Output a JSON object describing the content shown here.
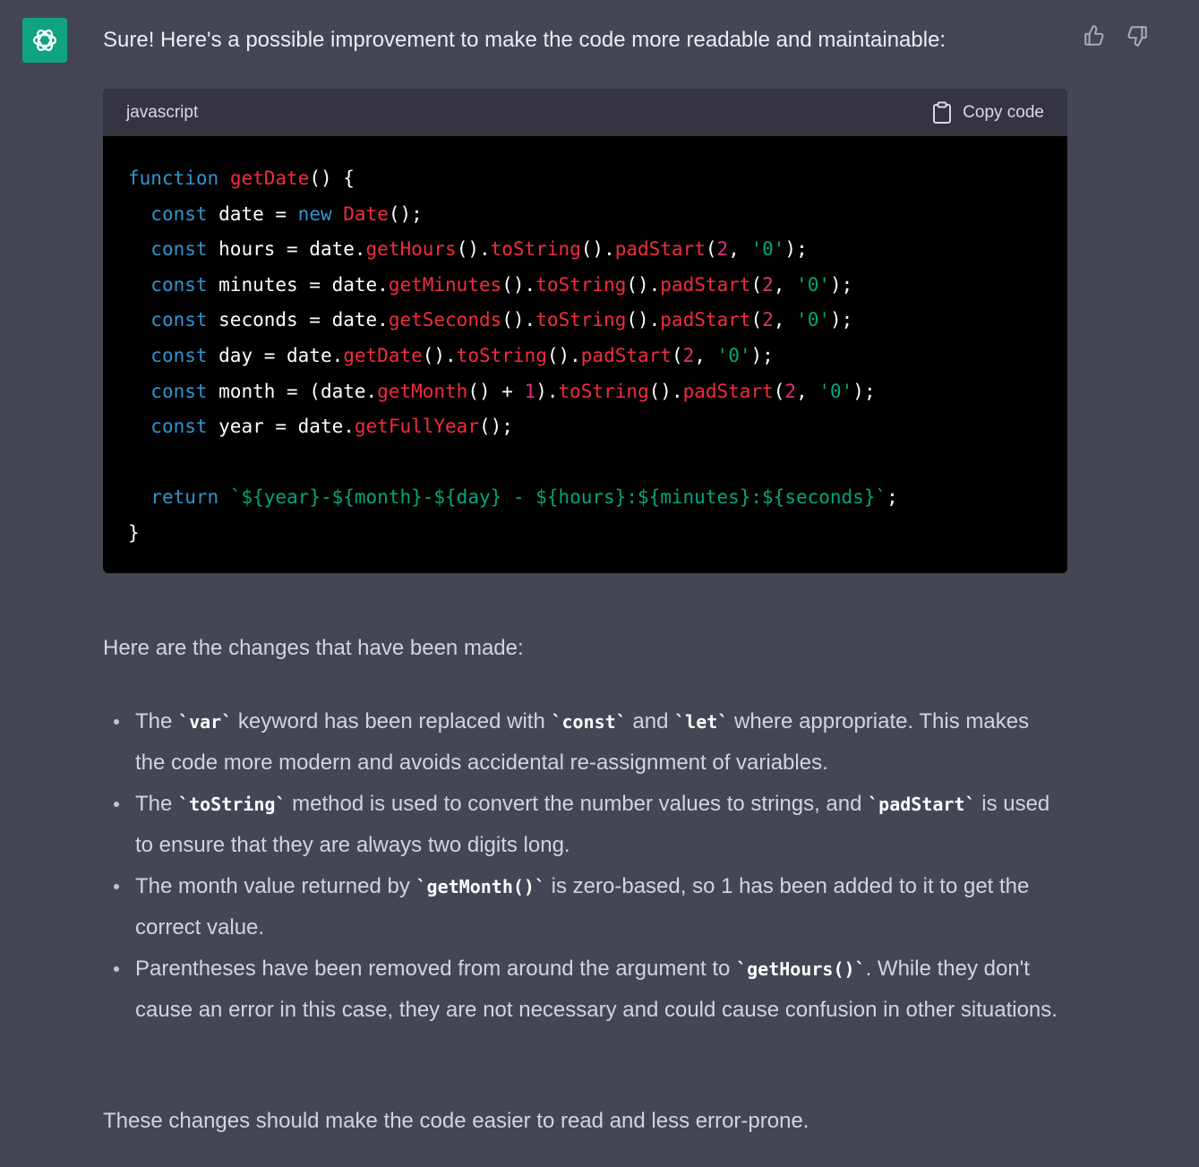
{
  "message": {
    "intro": "Sure! Here's a possible improvement to make the code more readable and maintainable:"
  },
  "feedback": {
    "thumbs_up_icon": "thumbs-up-icon",
    "thumbs_down_icon": "thumbs-down-icon"
  },
  "code_block": {
    "language": "javascript",
    "copy_label": "Copy code",
    "lines": [
      [
        {
          "t": "function",
          "c": "kw"
        },
        {
          "t": " "
        },
        {
          "t": "getDate",
          "c": "fn"
        },
        {
          "t": "() {"
        }
      ],
      [
        {
          "t": "  "
        },
        {
          "t": "const",
          "c": "kw"
        },
        {
          "t": " date = "
        },
        {
          "t": "new",
          "c": "kw"
        },
        {
          "t": " "
        },
        {
          "t": "Date",
          "c": "fn"
        },
        {
          "t": "();"
        }
      ],
      [
        {
          "t": "  "
        },
        {
          "t": "const",
          "c": "kw"
        },
        {
          "t": " hours = date."
        },
        {
          "t": "getHours",
          "c": "fn"
        },
        {
          "t": "()."
        },
        {
          "t": "toString",
          "c": "fn"
        },
        {
          "t": "()."
        },
        {
          "t": "padStart",
          "c": "fn"
        },
        {
          "t": "("
        },
        {
          "t": "2",
          "c": "num"
        },
        {
          "t": ", "
        },
        {
          "t": "'0'",
          "c": "str"
        },
        {
          "t": ");"
        }
      ],
      [
        {
          "t": "  "
        },
        {
          "t": "const",
          "c": "kw"
        },
        {
          "t": " minutes = date."
        },
        {
          "t": "getMinutes",
          "c": "fn"
        },
        {
          "t": "()."
        },
        {
          "t": "toString",
          "c": "fn"
        },
        {
          "t": "()."
        },
        {
          "t": "padStart",
          "c": "fn"
        },
        {
          "t": "("
        },
        {
          "t": "2",
          "c": "num"
        },
        {
          "t": ", "
        },
        {
          "t": "'0'",
          "c": "str"
        },
        {
          "t": ");"
        }
      ],
      [
        {
          "t": "  "
        },
        {
          "t": "const",
          "c": "kw"
        },
        {
          "t": " seconds = date."
        },
        {
          "t": "getSeconds",
          "c": "fn"
        },
        {
          "t": "()."
        },
        {
          "t": "toString",
          "c": "fn"
        },
        {
          "t": "()."
        },
        {
          "t": "padStart",
          "c": "fn"
        },
        {
          "t": "("
        },
        {
          "t": "2",
          "c": "num"
        },
        {
          "t": ", "
        },
        {
          "t": "'0'",
          "c": "str"
        },
        {
          "t": ");"
        }
      ],
      [
        {
          "t": "  "
        },
        {
          "t": "const",
          "c": "kw"
        },
        {
          "t": " day = date."
        },
        {
          "t": "getDate",
          "c": "fn"
        },
        {
          "t": "()."
        },
        {
          "t": "toString",
          "c": "fn"
        },
        {
          "t": "()."
        },
        {
          "t": "padStart",
          "c": "fn"
        },
        {
          "t": "("
        },
        {
          "t": "2",
          "c": "num"
        },
        {
          "t": ", "
        },
        {
          "t": "'0'",
          "c": "str"
        },
        {
          "t": ");"
        }
      ],
      [
        {
          "t": "  "
        },
        {
          "t": "const",
          "c": "kw"
        },
        {
          "t": " month = (date."
        },
        {
          "t": "getMonth",
          "c": "fn"
        },
        {
          "t": "() + "
        },
        {
          "t": "1",
          "c": "num"
        },
        {
          "t": ")."
        },
        {
          "t": "toString",
          "c": "fn"
        },
        {
          "t": "()."
        },
        {
          "t": "padStart",
          "c": "fn"
        },
        {
          "t": "("
        },
        {
          "t": "2",
          "c": "num"
        },
        {
          "t": ", "
        },
        {
          "t": "'0'",
          "c": "str"
        },
        {
          "t": ");"
        }
      ],
      [
        {
          "t": "  "
        },
        {
          "t": "const",
          "c": "kw"
        },
        {
          "t": " year = date."
        },
        {
          "t": "getFullYear",
          "c": "fn"
        },
        {
          "t": "();"
        }
      ],
      [],
      [
        {
          "t": "  "
        },
        {
          "t": "return",
          "c": "kw"
        },
        {
          "t": " "
        },
        {
          "t": "`${year}-${month}-${day} - ${hours}:${minutes}:${seconds}`",
          "c": "str"
        },
        {
          "t": ";"
        }
      ],
      [
        {
          "t": "}"
        }
      ]
    ]
  },
  "explanation": {
    "heading": "Here are the changes that have been made:",
    "bullets": [
      [
        {
          "t": "The "
        },
        {
          "t": "`var`",
          "code": true
        },
        {
          "t": " keyword has been replaced with "
        },
        {
          "t": "`const`",
          "code": true
        },
        {
          "t": " and "
        },
        {
          "t": "`let`",
          "code": true
        },
        {
          "t": " where appropriate. This makes the code more modern and avoids accidental re-assignment of variables."
        }
      ],
      [
        {
          "t": "The "
        },
        {
          "t": "`toString`",
          "code": true
        },
        {
          "t": " method is used to convert the number values to strings, and "
        },
        {
          "t": "`padStart`",
          "code": true
        },
        {
          "t": " is used to ensure that they are always two digits long."
        }
      ],
      [
        {
          "t": "The month value returned by "
        },
        {
          "t": "`getMonth()`",
          "code": true
        },
        {
          "t": " is zero-based, so 1 has been added to it to get the correct value."
        }
      ],
      [
        {
          "t": "Parentheses have been removed from around the argument to "
        },
        {
          "t": "`getHours()`",
          "code": true
        },
        {
          "t": ". While they don't cause an error in this case, they are not necessary and could cause confusion in other situations."
        }
      ]
    ],
    "closing": "These changes should make the code easier to read and less error-prone."
  }
}
